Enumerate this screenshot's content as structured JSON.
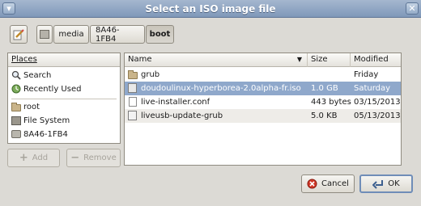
{
  "window": {
    "title": "Select an ISO image file"
  },
  "path_bar": {
    "segments": [
      "media",
      "8A46-1FB4",
      "boot"
    ],
    "active_segment": "boot"
  },
  "places": {
    "header": "Places",
    "items": [
      {
        "label": "Search",
        "icon": "search-icon"
      },
      {
        "label": "Recently Used",
        "icon": "recent-icon"
      },
      {
        "label": "root",
        "icon": "folder-icon"
      },
      {
        "label": "File System",
        "icon": "filesystem-icon"
      },
      {
        "label": "8A46-1FB4",
        "icon": "drive-icon"
      }
    ],
    "add_label": "Add",
    "remove_label": "Remove"
  },
  "files": {
    "columns": {
      "name": "Name",
      "size": "Size",
      "modified": "Modified"
    },
    "rows": [
      {
        "name": "grub",
        "size": "",
        "modified": "Friday",
        "icon": "folder-icon"
      },
      {
        "name": "doudoulinux-hyperborea-2.0alpha-fr.iso",
        "size": "1.0 GB",
        "modified": "Saturday",
        "icon": "iso-icon",
        "selected": true
      },
      {
        "name": "live-installer.conf",
        "size": "443 bytes",
        "modified": "03/15/2013",
        "icon": "file-icon"
      },
      {
        "name": "liveusb-update-grub",
        "size": "5.0 KB",
        "modified": "05/13/2013",
        "icon": "script-icon"
      }
    ]
  },
  "actions": {
    "cancel_label": "Cancel",
    "ok_label": "OK"
  },
  "colors": {
    "titlebar": "#8aa0c0",
    "selection": "#8fa8cb",
    "window_bg": "#dcdad5"
  }
}
